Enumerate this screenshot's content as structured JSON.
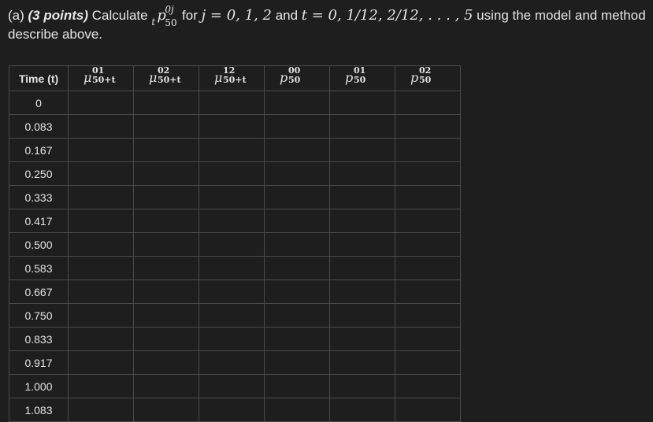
{
  "question": {
    "prefix": "(a) ",
    "points": "(3 points)",
    "calculate": " Calculate ",
    "symbol": {
      "pre_sub": "t",
      "base": "p",
      "sup": "0j",
      "sub": "50"
    },
    "for_text": " for ",
    "j_expr": "j = 0, 1, 2",
    "and_text": " and ",
    "t_expr": "t = 0, 1/12, 2/12, . . . , 5",
    "tail": " using the model and method describe above."
  },
  "table": {
    "headers": {
      "time": "Time (t)",
      "mu01": {
        "base": "μ",
        "sup": "01",
        "sub": "50+t"
      },
      "mu02": {
        "base": "μ",
        "sup": "02",
        "sub": "50+t"
      },
      "mu12": {
        "base": "μ",
        "sup": "12",
        "sub": "50+t"
      },
      "p00": {
        "base": "p",
        "sup": "00",
        "sub": "50"
      },
      "p01": {
        "base": "p",
        "sup": "01",
        "sub": "50"
      },
      "p02": {
        "base": "p",
        "sup": "02",
        "sub": "50"
      }
    },
    "rows": [
      {
        "time": "0"
      },
      {
        "time": "0.083"
      },
      {
        "time": "0.167"
      },
      {
        "time": "0.250"
      },
      {
        "time": "0.333"
      },
      {
        "time": "0.417"
      },
      {
        "time": "0.500"
      },
      {
        "time": "0.583"
      },
      {
        "time": "0.667"
      },
      {
        "time": "0.750"
      },
      {
        "time": "0.833"
      },
      {
        "time": "0.917"
      },
      {
        "time": "1.000"
      },
      {
        "time": "1.083"
      }
    ]
  }
}
